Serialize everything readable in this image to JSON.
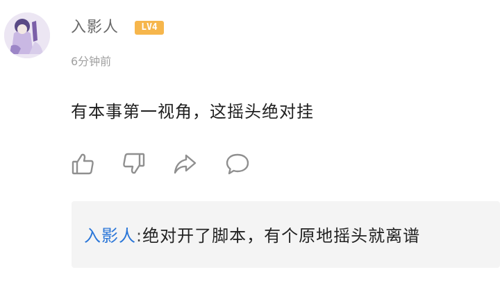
{
  "comment": {
    "username": "入影人",
    "level_badge": "LV4",
    "timestamp": "6分钟前",
    "text": "有本事第一视角，这摇头绝对挂"
  },
  "actions": [
    {
      "icon": "thumbs-up-icon"
    },
    {
      "icon": "thumbs-down-icon"
    },
    {
      "icon": "share-icon"
    },
    {
      "icon": "comment-bubble-icon"
    }
  ],
  "reply": {
    "author": "入影人",
    "separator": ":",
    "text": "绝对开了脚本，有个原地摇头就离谱"
  },
  "colors": {
    "badge": "#f6b64c",
    "reply_author": "#2a76d8",
    "reply_background": "#f4f4f4",
    "icon_stroke": "#8f8f8f"
  }
}
